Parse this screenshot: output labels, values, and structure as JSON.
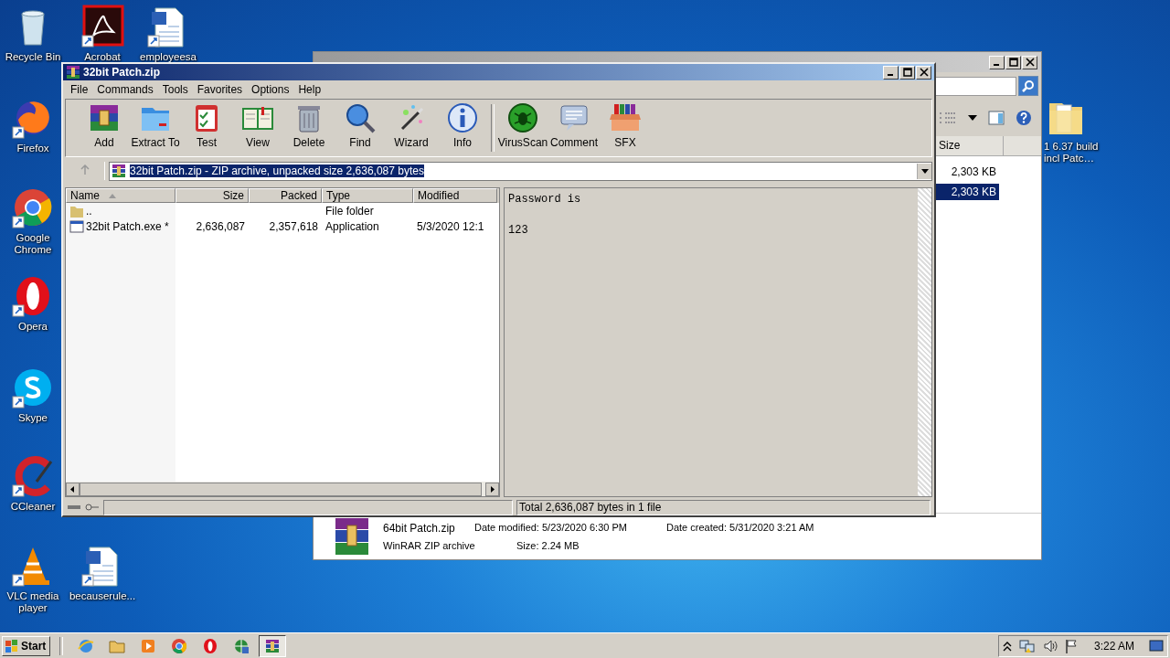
{
  "desktop_icons": [
    {
      "label": "Recycle Bin",
      "kind": "recycle"
    },
    {
      "label": "Acrobat",
      "kind": "acrobat"
    },
    {
      "label": "employeesa",
      "kind": "word"
    },
    {
      "label": "Firefox",
      "kind": "firefox"
    },
    {
      "label": "Google Chrome",
      "kind": "chrome"
    },
    {
      "label": "Opera",
      "kind": "opera"
    },
    {
      "label": "Skype",
      "kind": "skype"
    },
    {
      "label": "CCleaner",
      "kind": "ccleaner"
    },
    {
      "label": "VLC media player",
      "kind": "vlc"
    },
    {
      "label": "becauserule...",
      "kind": "word"
    },
    {
      "label": "1 6.37 build incl Patc…",
      "kind": "folder"
    }
  ],
  "explorer": {
    "size_header": "Size",
    "rows": [
      {
        "size": "2,303 KB",
        "selected": false
      },
      {
        "size": "2,303 KB",
        "selected": true
      }
    ],
    "details": {
      "name": "64bit Patch.zip",
      "type": "WinRAR ZIP archive",
      "modified": "Date modified: 5/23/2020 6:30 PM",
      "created": "Date created: 5/31/2020 3:21 AM",
      "size": "Size: 2.24 MB"
    }
  },
  "winrar": {
    "title": "32bit Patch.zip",
    "menu": [
      "File",
      "Commands",
      "Tools",
      "Favorites",
      "Options",
      "Help"
    ],
    "toolbar": [
      {
        "label": "Add",
        "kind": "add"
      },
      {
        "label": "Extract To",
        "kind": "extract"
      },
      {
        "label": "Test",
        "kind": "test"
      },
      {
        "label": "View",
        "kind": "view"
      },
      {
        "label": "Delete",
        "kind": "delete"
      },
      {
        "label": "Find",
        "kind": "find"
      },
      {
        "label": "Wizard",
        "kind": "wizard"
      },
      {
        "label": "Info",
        "kind": "info"
      },
      {
        "label": "VirusScan",
        "kind": "virus"
      },
      {
        "label": "Comment",
        "kind": "comment"
      },
      {
        "label": "SFX",
        "kind": "sfx"
      }
    ],
    "address": "32bit Patch.zip - ZIP archive, unpacked size 2,636,087 bytes",
    "columns": [
      "Name",
      "Size",
      "Packed",
      "Type",
      "Modified"
    ],
    "rows": [
      {
        "name": "..",
        "type": "File folder",
        "kind": "folder"
      },
      {
        "name": "32bit Patch.exe *",
        "size": "2,636,087",
        "packed": "2,357,618",
        "type": "Application",
        "modified": "5/3/2020 12:1",
        "kind": "exe"
      }
    ],
    "comment": "Password is\n\n123",
    "status": "Total 2,636,087 bytes in 1 file"
  },
  "taskbar": {
    "start": "Start",
    "items": [
      {
        "kind": "ie",
        "selected": false
      },
      {
        "kind": "explorer",
        "selected": false
      },
      {
        "kind": "media",
        "selected": false
      },
      {
        "kind": "chrome",
        "selected": false
      },
      {
        "kind": "opera",
        "selected": false
      },
      {
        "kind": "network",
        "selected": false
      },
      {
        "kind": "winrar",
        "selected": true
      }
    ],
    "clock": "3:22 AM"
  }
}
